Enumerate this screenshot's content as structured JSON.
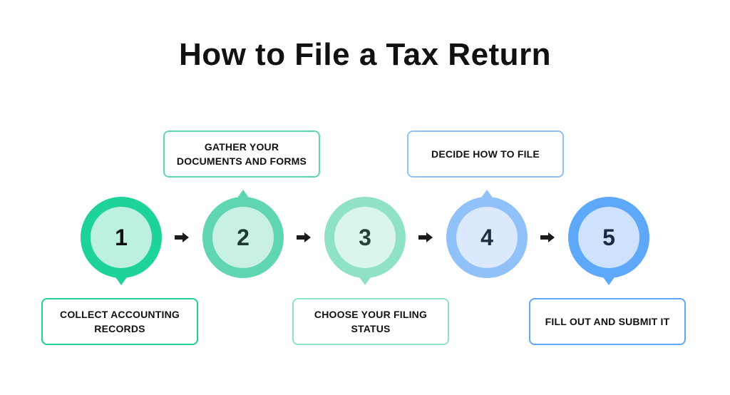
{
  "title": "How to File a Tax Return",
  "steps": [
    {
      "number": "1",
      "label": "COLLECT ACCOUNTING RECORDS",
      "label_position": "below",
      "outer_color": "#1dd39a",
      "inner_color": "#bdf0de",
      "text_color": "#111111",
      "box_border": "#22cf96"
    },
    {
      "number": "2",
      "label": "GATHER YOUR DOCUMENTS AND FORMS",
      "label_position": "above",
      "outer_color": "#5fd6b1",
      "inner_color": "#c9f1e3",
      "text_color": "#1c3b30",
      "box_border": "#5fd6b1"
    },
    {
      "number": "3",
      "label": "CHOOSE YOUR FILING STATUS",
      "label_position": "below",
      "outer_color": "#8fe2c8",
      "inner_color": "#daf6ec",
      "text_color": "#23413a",
      "box_border": "#8fe2c8"
    },
    {
      "number": "4",
      "label": "DECIDE HOW TO FILE",
      "label_position": "above",
      "outer_color": "#90c1f9",
      "inner_color": "#dce9fd",
      "text_color": "#1f2d40",
      "box_border": "#90c1f9"
    },
    {
      "number": "5",
      "label": "FILL OUT AND SUBMIT IT",
      "label_position": "below",
      "outer_color": "#5ea8fa",
      "inner_color": "#cfe2fd",
      "text_color": "#1b2a40",
      "box_border": "#5ea8fa"
    }
  ],
  "arrow_color": "#1a1a1a"
}
